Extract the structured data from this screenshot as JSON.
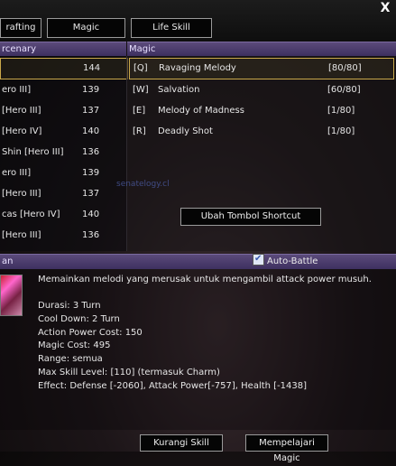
{
  "tabs": [
    {
      "label": "rafting"
    },
    {
      "label": "Magic"
    },
    {
      "label": "Life Skill"
    }
  ],
  "close_label": "X",
  "mercenary": {
    "header": "rcenary",
    "rows": [
      {
        "name": "",
        "level": "144"
      },
      {
        "name": "ero III]",
        "level": "139"
      },
      {
        "name": "[Hero III]",
        "level": "137"
      },
      {
        "name": "[Hero IV]",
        "level": "140"
      },
      {
        "name": "Shin [Hero III]",
        "level": "136"
      },
      {
        "name": "ero III]",
        "level": "139"
      },
      {
        "name": "[Hero III]",
        "level": "137"
      },
      {
        "name": "cas [Hero IV]",
        "level": "140"
      },
      {
        "name": "[Hero III]",
        "level": "136"
      }
    ]
  },
  "magic": {
    "header": "Magic",
    "rows": [
      {
        "key": "[Q]",
        "name": "Ravaging Melody",
        "uses": "[80/80]"
      },
      {
        "key": "[W]",
        "name": "Salvation",
        "uses": "[60/80]"
      },
      {
        "key": "[E]",
        "name": "Melody of Madness",
        "uses": "[1/80]"
      },
      {
        "key": "[R]",
        "name": "Deadly Shot",
        "uses": "[1/80]"
      }
    ],
    "shortcut_label": "Ubah Tombol Shortcut",
    "watermark": "senatelogy.cl"
  },
  "detail": {
    "header": "an",
    "auto_battle_label": "Auto-Battle",
    "description": "Memainkan melodi yang merusak untuk mengambil attack power musuh.",
    "stats": [
      "Durasi: 3 Turn",
      "Cool Down: 2 Turn",
      "Action Power Cost: 150",
      "Magic Cost: 495",
      "Range: semua",
      "Max Skill Level: [110] (termasuk Charm)",
      "Effect: Defense [-2060], Attack Power[-757], Health [-1438]"
    ]
  },
  "buttons": {
    "reduce_label": "Kurangi Skill",
    "learn_label": "Mempelajari Magic"
  }
}
